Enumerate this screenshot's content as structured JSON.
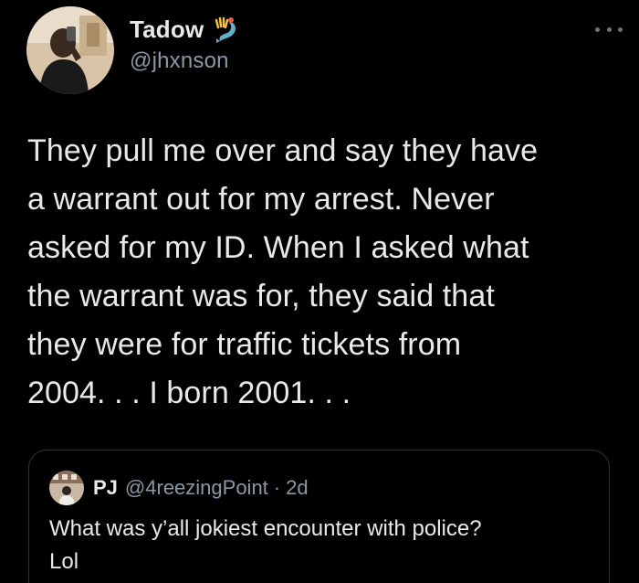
{
  "tweet": {
    "author": {
      "display_name": "Tadow",
      "handle": "@jhxnson",
      "name_emoji_icon": "mermaid-emoji-icon"
    },
    "more_icon": "more-horizontal-icon",
    "text": "They pull me over and say they have\na warrant out for my arrest.  Never\nasked for my ID.  When I asked what\nthe warrant was for, they said that\nthey were for traffic tickets from\n2004. . . I born 2001. . .",
    "quoted_tweet": {
      "display_name": "PJ",
      "handle": "@4reezingPoint",
      "separator": "·",
      "time": "2d",
      "text": "What was y’all jokiest encounter with police?\nLol"
    }
  },
  "colors": {
    "background": "#000000",
    "primary_text": "#e7e9ea",
    "secondary_text": "#8b98a5",
    "border": "#2f3336"
  }
}
